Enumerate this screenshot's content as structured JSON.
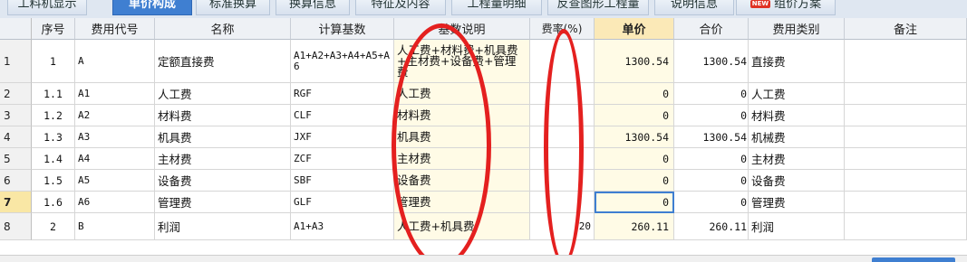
{
  "tabs": [
    {
      "label": "工料机显示",
      "active": false
    },
    {
      "label": "单价构成",
      "active": true
    },
    {
      "label": "标准换算",
      "active": false
    },
    {
      "label": "换算信息",
      "active": false
    },
    {
      "label": "特征及内容",
      "active": false
    },
    {
      "label": "工程量明细",
      "active": false
    },
    {
      "label": "反查图形工程量",
      "active": false
    },
    {
      "label": "说明信息",
      "active": false
    },
    {
      "label": "组价方案",
      "active": false,
      "badge": "NEW"
    }
  ],
  "columns": {
    "rownum": "",
    "seq": "序号",
    "code": "费用代号",
    "name": "名称",
    "base": "计算基数",
    "desc": "基数说明",
    "rate": "费率(%)",
    "price": "单价",
    "total": "合价",
    "category": "费用类别",
    "remark": "备注"
  },
  "rows": [
    {
      "rownum": "1",
      "seq": "1",
      "code": "A",
      "name": "定额直接费",
      "base": "A1+A2+A3+A4+A5+A6",
      "desc": "人工费+材料费+机具费+主材费+设备费+管理费",
      "rate": "",
      "price": "1300.54",
      "total": "1300.54",
      "category": "直接费",
      "remark": ""
    },
    {
      "rownum": "2",
      "seq": "1.1",
      "code": "A1",
      "name": "人工费",
      "base": "RGF",
      "desc": "人工费",
      "rate": "",
      "price": "0",
      "total": "0",
      "category": "人工费",
      "remark": ""
    },
    {
      "rownum": "3",
      "seq": "1.2",
      "code": "A2",
      "name": "材料费",
      "base": "CLF",
      "desc": "材料费",
      "rate": "",
      "price": "0",
      "total": "0",
      "category": "材料费",
      "remark": ""
    },
    {
      "rownum": "4",
      "seq": "1.3",
      "code": "A3",
      "name": "机具费",
      "base": "JXF",
      "desc": "机具费",
      "rate": "",
      "price": "1300.54",
      "total": "1300.54",
      "category": "机械费",
      "remark": ""
    },
    {
      "rownum": "5",
      "seq": "1.4",
      "code": "A4",
      "name": "主材费",
      "base": "ZCF",
      "desc": "主材费",
      "rate": "",
      "price": "0",
      "total": "0",
      "category": "主材费",
      "remark": ""
    },
    {
      "rownum": "6",
      "seq": "1.5",
      "code": "A5",
      "name": "设备费",
      "base": "SBF",
      "desc": "设备费",
      "rate": "",
      "price": "0",
      "total": "0",
      "category": "设备费",
      "remark": ""
    },
    {
      "rownum": "7",
      "seq": "1.6",
      "code": "A6",
      "name": "管理费",
      "base": "GLF",
      "desc": "管理费",
      "rate": "",
      "price": "0",
      "total": "0",
      "category": "管理费",
      "remark": "",
      "selected": true
    },
    {
      "rownum": "8",
      "seq": "2",
      "code": "B",
      "name": "利润",
      "base": "A1+A3",
      "desc": "人工费+机具费",
      "rate": "20",
      "price": "260.11",
      "total": "260.11",
      "category": "利润",
      "remark": ""
    }
  ],
  "annotation_color": "#e4201f"
}
